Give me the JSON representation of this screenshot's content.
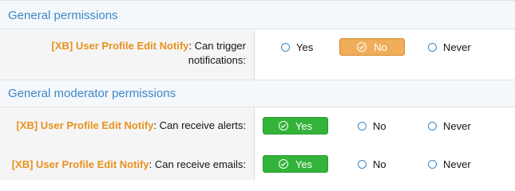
{
  "sections": [
    {
      "title": "General permissions",
      "rows": [
        {
          "addon": "[XB] User Profile Edit Notify",
          "text_line1": ": Can trigger",
          "text_line2": "notifications:",
          "options": [
            "Yes",
            "No",
            "Never"
          ],
          "selected": "No",
          "selected_color": "#f0ad5a"
        }
      ]
    },
    {
      "title": "General moderator permissions",
      "rows": [
        {
          "addon": "[XB] User Profile Edit Notify",
          "text": ": Can receive alerts:",
          "options": [
            "Yes",
            "No",
            "Never"
          ],
          "selected": "Yes",
          "selected_color": "#33b33a"
        },
        {
          "addon": "[XB] User Profile Edit Notify",
          "text": ": Can receive emails:",
          "options": [
            "Yes",
            "No",
            "Never"
          ],
          "selected": "Yes",
          "selected_color": "#33b33a"
        }
      ]
    }
  ],
  "icons": {
    "selected": "check-circle-icon",
    "unselected": "radio-empty-icon"
  }
}
